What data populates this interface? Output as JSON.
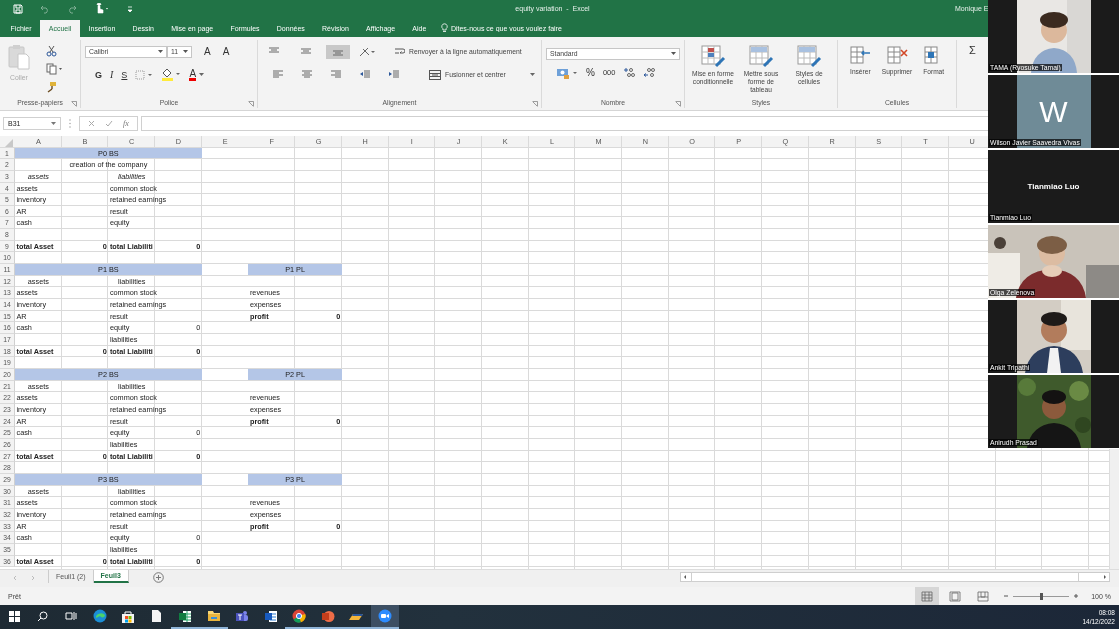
{
  "titlebar": {
    "title": "equity variation  -  Excel",
    "user": "Monique E"
  },
  "menu_tabs": [
    {
      "label": "Fichier",
      "selected": false
    },
    {
      "label": "Accueil",
      "selected": true
    },
    {
      "label": "Insertion",
      "selected": false
    },
    {
      "label": "Dessin",
      "selected": false
    },
    {
      "label": "Mise en page",
      "selected": false
    },
    {
      "label": "Formules",
      "selected": false
    },
    {
      "label": "Données",
      "selected": false
    },
    {
      "label": "Révision",
      "selected": false
    },
    {
      "label": "Affichage",
      "selected": false
    },
    {
      "label": "Aide",
      "selected": false
    }
  ],
  "tell_me": {
    "placeholder": "Dites-nous ce que vous voulez faire"
  },
  "ribbon": {
    "clipboard": {
      "title": "Presse-papiers",
      "paste": "Coller",
      "paste_disabled": true
    },
    "font": {
      "title": "Police",
      "family": "Calibri",
      "size": "11",
      "grow": "A",
      "shrink": "A",
      "bold": "G",
      "italic": "I",
      "underline": "S",
      "font_color": "A"
    },
    "alignment": {
      "title": "Alignement",
      "vertical": [
        {
          "selected": false
        },
        {
          "selected": false
        },
        {
          "selected": true
        }
      ],
      "wrap": "Renvoyer à la ligne automatiquement",
      "merge": "Fusionner et centrer"
    },
    "number": {
      "title": "Nombre",
      "format": "Standard",
      "percent": "%",
      "thousands": "000"
    },
    "styles": {
      "title": "Styles",
      "buttons": [
        "Mise en forme conditionnelle",
        "Mettre sous forme de tableau",
        "Styles de cellules"
      ]
    },
    "cells": {
      "title": "Cellules",
      "buttons": [
        "Insérer",
        "Supprimer",
        "Format"
      ]
    },
    "editing": {
      "sum": "Σ"
    }
  },
  "formula_bar": {
    "name_box": "B31",
    "fx": "fx"
  },
  "sheet": {
    "columns": [
      "A",
      "B",
      "C",
      "D",
      "E",
      "F",
      "G",
      "H",
      "I",
      "J",
      "K",
      "L",
      "M",
      "N",
      "O",
      "P",
      "Q",
      "R",
      "S",
      "T",
      "U"
    ],
    "rows": [
      {
        "number": "1",
        "cells": {
          "A:D": {
            "text": "P0 BS",
            "kind": "band"
          }
        }
      },
      {
        "number": "2",
        "cells": {
          "A:D": {
            "text": "creation of the company",
            "kind": "center"
          }
        }
      },
      {
        "number": "3",
        "cells": {
          "A": {
            "text": "assets",
            "kind": "italic"
          },
          "C": {
            "text": "liabilities",
            "kind": "italic"
          }
        }
      },
      {
        "number": "4",
        "cells": {
          "A": {
            "text": "assets",
            "kind": "text"
          },
          "C": {
            "text": "common stock",
            "kind": "text"
          }
        }
      },
      {
        "number": "5",
        "cells": {
          "A": {
            "text": "inventory",
            "kind": "text"
          },
          "C": {
            "text": "retained earnings",
            "kind": "text"
          }
        }
      },
      {
        "number": "6",
        "cells": {
          "A": {
            "text": "AR",
            "kind": "text"
          },
          "C": {
            "text": "result",
            "kind": "text"
          }
        }
      },
      {
        "number": "7",
        "cells": {
          "A": {
            "text": "cash",
            "kind": "text"
          },
          "C": {
            "text": "equity",
            "kind": "text"
          }
        }
      },
      {
        "number": "8",
        "cells": {}
      },
      {
        "number": "9",
        "cells": {
          "A": {
            "text": "total Asset",
            "kind": "bold"
          },
          "B": {
            "text": "0",
            "kind": "bold-number"
          },
          "C": {
            "text": "total Liabiliti",
            "kind": "bold"
          },
          "D": {
            "text": "0",
            "kind": "bold-number"
          }
        }
      },
      {
        "number": "10",
        "cells": {}
      },
      {
        "number": "11",
        "cells": {
          "A:D": {
            "text": "P1 BS",
            "kind": "band"
          },
          "F:G": {
            "text": "P1 PL",
            "kind": "band"
          }
        }
      },
      {
        "number": "12",
        "cells": {
          "A": {
            "text": "assets",
            "kind": "center"
          },
          "C": {
            "text": "liabilities",
            "kind": "center"
          }
        }
      },
      {
        "number": "13",
        "cells": {
          "A": {
            "text": "assets",
            "kind": "text"
          },
          "C": {
            "text": "common stock",
            "kind": "text"
          },
          "F": {
            "text": "revenues",
            "kind": "text"
          }
        }
      },
      {
        "number": "14",
        "cells": {
          "A": {
            "text": "inventory",
            "kind": "text"
          },
          "C": {
            "text": "retained earnings",
            "kind": "text"
          },
          "F": {
            "text": "expenses",
            "kind": "text"
          }
        }
      },
      {
        "number": "15",
        "cells": {
          "A": {
            "text": "AR",
            "kind": "text"
          },
          "C": {
            "text": "result",
            "kind": "text"
          },
          "F": {
            "text": "profit",
            "kind": "bold"
          },
          "G": {
            "text": "0",
            "kind": "bold-number"
          }
        }
      },
      {
        "number": "16",
        "cells": {
          "A": {
            "text": "cash",
            "kind": "text"
          },
          "C": {
            "text": "equity",
            "kind": "text"
          },
          "D": {
            "text": "0",
            "kind": "number"
          }
        }
      },
      {
        "number": "17",
        "cells": {
          "C": {
            "text": "liabilities",
            "kind": "text"
          }
        }
      },
      {
        "number": "18",
        "cells": {
          "A": {
            "text": "total Asset",
            "kind": "bold"
          },
          "B": {
            "text": "0",
            "kind": "bold-number"
          },
          "C": {
            "text": "total Liabiliti",
            "kind": "bold"
          },
          "D": {
            "text": "0",
            "kind": "bold-number"
          }
        }
      },
      {
        "number": "19",
        "cells": {}
      },
      {
        "number": "20",
        "cells": {
          "A:D": {
            "text": "P2 BS",
            "kind": "band"
          },
          "F:G": {
            "text": "P2 PL",
            "kind": "band"
          }
        }
      },
      {
        "number": "21",
        "cells": {
          "A": {
            "text": "assets",
            "kind": "center"
          },
          "C": {
            "text": "liabilities",
            "kind": "center"
          }
        }
      },
      {
        "number": "22",
        "cells": {
          "A": {
            "text": "assets",
            "kind": "text"
          },
          "C": {
            "text": "common stock",
            "kind": "text"
          },
          "F": {
            "text": "revenues",
            "kind": "text"
          }
        }
      },
      {
        "number": "23",
        "cells": {
          "A": {
            "text": "inventory",
            "kind": "text"
          },
          "C": {
            "text": "retained earnings",
            "kind": "text"
          },
          "F": {
            "text": "expenses",
            "kind": "text"
          }
        }
      },
      {
        "number": "24",
        "cells": {
          "A": {
            "text": "AR",
            "kind": "text"
          },
          "C": {
            "text": "result",
            "kind": "text"
          },
          "F": {
            "text": "profit",
            "kind": "bold"
          },
          "G": {
            "text": "0",
            "kind": "bold-number"
          }
        }
      },
      {
        "number": "25",
        "cells": {
          "A": {
            "text": "cash",
            "kind": "text"
          },
          "C": {
            "text": "equity",
            "kind": "text"
          },
          "D": {
            "text": "0",
            "kind": "number"
          }
        }
      },
      {
        "number": "26",
        "cells": {
          "C": {
            "text": "liabilities",
            "kind": "text"
          }
        }
      },
      {
        "number": "27",
        "cells": {
          "A": {
            "text": "total Asset",
            "kind": "bold"
          },
          "B": {
            "text": "0",
            "kind": "bold-number"
          },
          "C": {
            "text": "total Liabiliti",
            "kind": "bold"
          },
          "D": {
            "text": "0",
            "kind": "bold-number"
          }
        }
      },
      {
        "number": "28",
        "cells": {}
      },
      {
        "number": "29",
        "cells": {
          "A:D": {
            "text": "P3 BS",
            "kind": "band"
          },
          "F:G": {
            "text": "P3 PL",
            "kind": "band"
          }
        }
      },
      {
        "number": "30",
        "cells": {
          "A": {
            "text": "assets",
            "kind": "center"
          },
          "C": {
            "text": "liabilities",
            "kind": "center"
          }
        }
      },
      {
        "number": "31",
        "cells": {
          "A": {
            "text": "assets",
            "kind": "text"
          },
          "C": {
            "text": "common stock",
            "kind": "text"
          },
          "F": {
            "text": "revenues",
            "kind": "text"
          }
        }
      },
      {
        "number": "32",
        "cells": {
          "A": {
            "text": "inventory",
            "kind": "text"
          },
          "C": {
            "text": "retained earnings",
            "kind": "text"
          },
          "F": {
            "text": "expenses",
            "kind": "text"
          }
        }
      },
      {
        "number": "33",
        "cells": {
          "A": {
            "text": "AR",
            "kind": "text"
          },
          "C": {
            "text": "result",
            "kind": "text"
          },
          "F": {
            "text": "profit",
            "kind": "bold"
          },
          "G": {
            "text": "0",
            "kind": "bold-number"
          }
        }
      },
      {
        "number": "34",
        "cells": {
          "A": {
            "text": "cash",
            "kind": "text"
          },
          "C": {
            "text": "equity",
            "kind": "text"
          },
          "D": {
            "text": "0",
            "kind": "number"
          }
        }
      },
      {
        "number": "35",
        "cells": {
          "C": {
            "text": "liabilities",
            "kind": "text"
          }
        }
      },
      {
        "number": "36",
        "cells": {
          "A": {
            "text": "total Asset",
            "kind": "bold"
          },
          "B": {
            "text": "0",
            "kind": "bold-number"
          },
          "C": {
            "text": "total Liabiliti",
            "kind": "bold"
          },
          "D": {
            "text": "0",
            "kind": "bold-number"
          }
        }
      }
    ]
  },
  "sheet_tabs": [
    {
      "label": "Feuil1 (2)",
      "selected": false
    },
    {
      "label": "Feuil3",
      "selected": true
    }
  ],
  "status_bar": {
    "status": "Prêt",
    "views": [
      {
        "selected": true
      },
      {
        "selected": false
      },
      {
        "selected": false
      }
    ],
    "zoom": {
      "level": 0.5,
      "reading": "100 %"
    }
  },
  "participants": [
    {
      "name": "TAMA (Ryosuke Tamai)",
      "kind": "video"
    },
    {
      "name": "Wilson Javier Saavedra Vivas",
      "kind": "avatar",
      "initial": "W"
    },
    {
      "name": "Tianmiao Luo",
      "kind": "name-card",
      "display": "Tianmiao Luo"
    },
    {
      "name": "Olga Zelenova",
      "kind": "wide-video"
    },
    {
      "name": "Ankit Tripathi",
      "kind": "video"
    },
    {
      "name": "Anirudh Prasad",
      "kind": "video"
    }
  ],
  "taskbar": {
    "apps": [
      {
        "kind": "start",
        "running": false,
        "selected": false
      },
      {
        "kind": "search",
        "running": false,
        "selected": false
      },
      {
        "kind": "task-view",
        "running": false,
        "selected": false
      },
      {
        "kind": "globe",
        "running": false,
        "selected": false
      },
      {
        "kind": "bag",
        "running": false,
        "selected": false
      },
      {
        "kind": "document",
        "running": false,
        "selected": false
      },
      {
        "kind": "spreadsheet",
        "running": true,
        "selected": false
      },
      {
        "kind": "folder",
        "running": true,
        "selected": false
      },
      {
        "kind": "people",
        "running": false,
        "selected": false
      },
      {
        "kind": "text-doc",
        "running": false,
        "selected": false
      },
      {
        "kind": "ring",
        "running": true,
        "selected": false
      },
      {
        "kind": "slides",
        "running": true,
        "selected": false
      },
      {
        "kind": "tool",
        "running": true,
        "selected": false
      },
      {
        "kind": "camera",
        "running": true,
        "selected": true
      }
    ],
    "time": "08:08",
    "date": "14/12/2022"
  }
}
